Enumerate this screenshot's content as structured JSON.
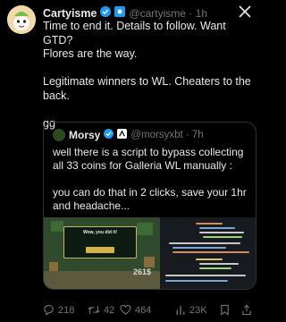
{
  "tweet": {
    "author_name": "Cartyisme",
    "handle_time": "@cartyisme · 1h",
    "text": "Time to end it. Details to follow. Want GTD?\nFlores are the way.\n\nLegitimate winners to WL. Cheaters to the\nback.\n\ngg"
  },
  "quote": {
    "author_name": "Morsy",
    "handle_time": "@morsyxbt · 7h",
    "text": "well there is a script to bypass collecting\nall 33 coins for Galleria WL manually :\n\nyou can do that in 2 clicks, save your 1hr\nand headache...",
    "media": {
      "modal_title": "Wow, you did it!",
      "score": "261$"
    }
  },
  "actions": {
    "replies": "218",
    "retweets": "42",
    "likes": "464",
    "views": "23K"
  },
  "colors": {
    "background": "#000000",
    "text": "#e7e9ea",
    "secondary": "#71767b",
    "verified": "#1d9bf0",
    "border": "#2f3336"
  }
}
